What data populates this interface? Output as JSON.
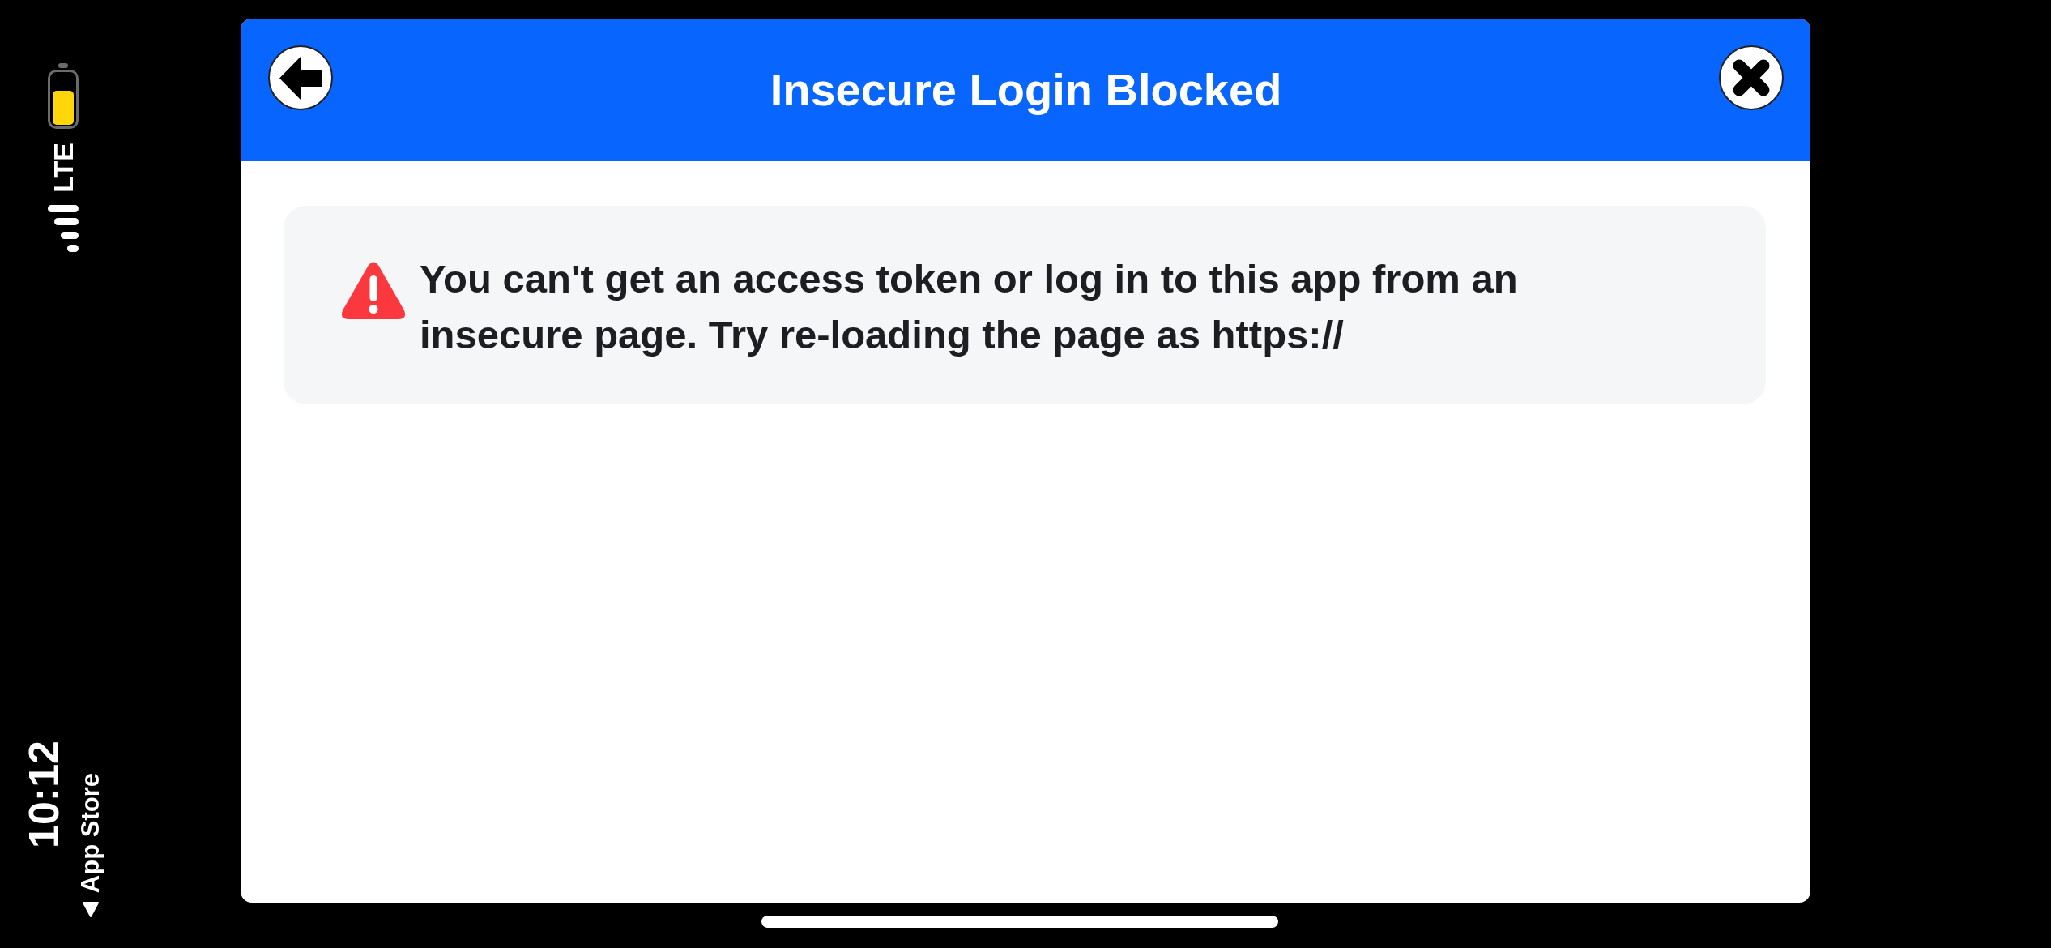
{
  "status_bar": {
    "network": "LTE",
    "time": "10:12",
    "back_link": "App Store"
  },
  "dialog": {
    "title": "Insecure Login Blocked",
    "notice": {
      "kind": "warning",
      "text": "You can't get an access token or log in to this app from an insecure page. Try re-loading the page as https://"
    }
  }
}
